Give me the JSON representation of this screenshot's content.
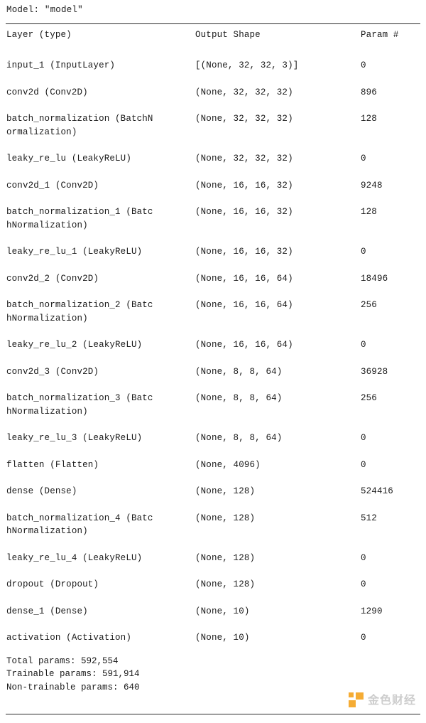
{
  "title": "Model: \"model\"",
  "columns": {
    "layer": "Layer (type)",
    "shape": "Output Shape",
    "param": "Param #"
  },
  "separators": {
    "equals": "================================================================="
  },
  "rows": [
    {
      "layer": "input_1 (InputLayer)",
      "layer_cont": "",
      "shape": "[(None, 32, 32, 3)]",
      "param": "0"
    },
    {
      "layer": "conv2d (Conv2D)",
      "layer_cont": "",
      "shape": "(None, 32, 32, 32)",
      "param": "896"
    },
    {
      "layer": "batch_normalization (BatchN",
      "layer_cont": "ormalization)",
      "shape": "(None, 32, 32, 32)",
      "param": "128"
    },
    {
      "layer": "leaky_re_lu (LeakyReLU)",
      "layer_cont": "",
      "shape": "(None, 32, 32, 32)",
      "param": "0"
    },
    {
      "layer": "conv2d_1 (Conv2D)",
      "layer_cont": "",
      "shape": "(None, 16, 16, 32)",
      "param": "9248"
    },
    {
      "layer": "batch_normalization_1 (Batc",
      "layer_cont": "hNormalization)",
      "shape": "(None, 16, 16, 32)",
      "param": "128"
    },
    {
      "layer": "leaky_re_lu_1 (LeakyReLU)",
      "layer_cont": "",
      "shape": "(None, 16, 16, 32)",
      "param": "0"
    },
    {
      "layer": "conv2d_2 (Conv2D)",
      "layer_cont": "",
      "shape": "(None, 16, 16, 64)",
      "param": "18496"
    },
    {
      "layer": "batch_normalization_2 (Batc",
      "layer_cont": "hNormalization)",
      "shape": "(None, 16, 16, 64)",
      "param": "256"
    },
    {
      "layer": "leaky_re_lu_2 (LeakyReLU)",
      "layer_cont": "",
      "shape": "(None, 16, 16, 64)",
      "param": "0"
    },
    {
      "layer": "conv2d_3 (Conv2D)",
      "layer_cont": "",
      "shape": "(None, 8, 8, 64)",
      "param": "36928"
    },
    {
      "layer": "batch_normalization_3 (Batc",
      "layer_cont": "hNormalization)",
      "shape": "(None, 8, 8, 64)",
      "param": "256"
    },
    {
      "layer": "leaky_re_lu_3 (LeakyReLU)",
      "layer_cont": "",
      "shape": "(None, 8, 8, 64)",
      "param": "0"
    },
    {
      "layer": "flatten (Flatten)",
      "layer_cont": "",
      "shape": "(None, 4096)",
      "param": "0"
    },
    {
      "layer": "dense (Dense)",
      "layer_cont": "",
      "shape": "(None, 128)",
      "param": "524416"
    },
    {
      "layer": "batch_normalization_4 (Batc",
      "layer_cont": "hNormalization)",
      "shape": "(None, 128)",
      "param": "512"
    },
    {
      "layer": "leaky_re_lu_4 (LeakyReLU)",
      "layer_cont": "",
      "shape": "(None, 128)",
      "param": "0"
    },
    {
      "layer": "dropout (Dropout)",
      "layer_cont": "",
      "shape": "(None, 128)",
      "param": "0"
    },
    {
      "layer": "dense_1 (Dense)",
      "layer_cont": "",
      "shape": "(None, 10)",
      "param": "1290"
    },
    {
      "layer": "activation (Activation)",
      "layer_cont": "",
      "shape": "(None, 10)",
      "param": "0"
    }
  ],
  "totals": {
    "total": "Total params: 592,554",
    "trainable": "Trainable params: 591,914",
    "non_trainable": "Non-trainable params: 640"
  },
  "watermark": {
    "text": "金色财经",
    "logo_color": "#f5a623"
  }
}
